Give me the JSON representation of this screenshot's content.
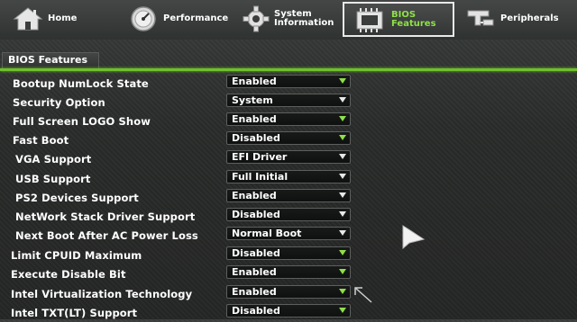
{
  "nav": {
    "tabs": [
      {
        "label": "Home",
        "icon": "home-icon",
        "active": false
      },
      {
        "label": "Performance",
        "icon": "speedometer-icon",
        "active": false
      },
      {
        "label_line1": "System",
        "label_line2": "Information",
        "icon": "gear-icon",
        "active": false
      },
      {
        "label_line1": "BIOS",
        "label_line2": "Features",
        "icon": "bios-chip-icon",
        "active": true
      },
      {
        "label": "Peripherals",
        "icon": "peripherals-icon",
        "active": false
      }
    ]
  },
  "section": {
    "title": "BIOS Features"
  },
  "settings": [
    {
      "name": "Bootup NumLock State",
      "value": "Enabled"
    },
    {
      "name": "Security Option",
      "value": "System"
    },
    {
      "name": "Full Screen LOGO Show",
      "value": "Enabled"
    },
    {
      "name": "Fast Boot",
      "value": "Disabled"
    },
    {
      "name": "VGA Support",
      "value": "EFI Driver"
    },
    {
      "name": "USB Support",
      "value": "Full Initial"
    },
    {
      "name": "PS2 Devices Support",
      "value": "Enabled"
    },
    {
      "name": "NetWork Stack Driver Support",
      "value": "Disabled"
    },
    {
      "name": "Next Boot After AC Power Loss",
      "value": "Normal Boot"
    },
    {
      "name": "Limit CPUID Maximum",
      "value": "Disabled"
    },
    {
      "name": "Execute Disable Bit",
      "value": "Enabled"
    },
    {
      "name": "Intel Virtualization Technology",
      "value": "Enabled"
    },
    {
      "name": "Intel TXT(LT) Support",
      "value": "Disabled"
    }
  ],
  "colors": {
    "accent": "#6ec02c",
    "active_label": "#8ee04a",
    "background": "#2b2e2d"
  }
}
